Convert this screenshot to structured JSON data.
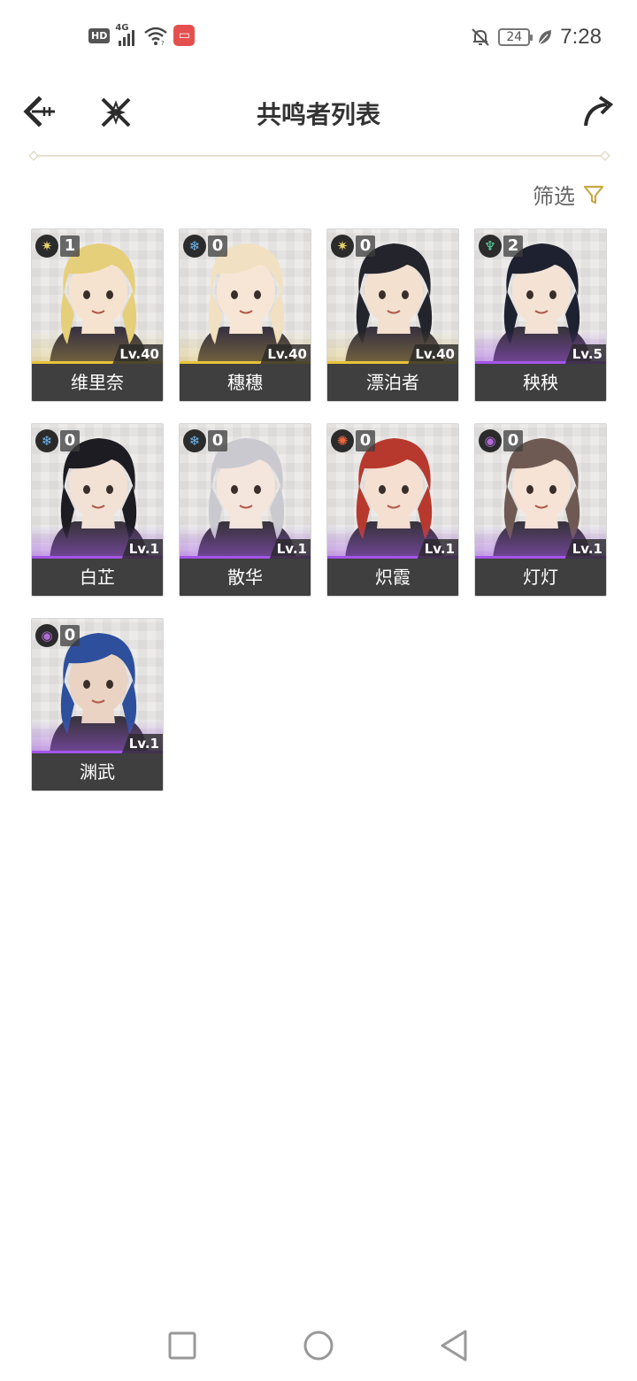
{
  "status_bar": {
    "hd_label": "HD",
    "network_label": "4G",
    "battery_level": "24",
    "time": "7:28"
  },
  "header": {
    "title": "共鸣者列表"
  },
  "filter": {
    "label": "筛选"
  },
  "colors": {
    "five_star": "#e8c23a",
    "four_star": "#a455e8",
    "card_name_bg": "#3f3f3f"
  },
  "characters": [
    {
      "name": "维里奈",
      "chain": "1",
      "level": "Lv.40",
      "element": "spectro-icon",
      "rarity": 5,
      "hair": "#e6cf7a",
      "skin": "#f6e3cf"
    },
    {
      "name": "穗穗",
      "chain": "0",
      "level": "Lv.40",
      "element": "glacio-icon",
      "rarity": 5,
      "hair": "#f1e1c2",
      "skin": "#f7e6d6"
    },
    {
      "name": "漂泊者",
      "chain": "0",
      "level": "Lv.40",
      "element": "spectro-icon",
      "rarity": 5,
      "hair": "#23242c",
      "skin": "#f3e0cf"
    },
    {
      "name": "秧秧",
      "chain": "2",
      "level": "Lv.5",
      "element": "aero-icon",
      "rarity": 4,
      "hair": "#1e2130",
      "skin": "#f4e3d5"
    },
    {
      "name": "白芷",
      "chain": "0",
      "level": "Lv.1",
      "element": "glacio-icon",
      "rarity": 4,
      "hair": "#1c1c22",
      "skin": "#f2e2d6"
    },
    {
      "name": "散华",
      "chain": "0",
      "level": "Lv.1",
      "element": "glacio-icon",
      "rarity": 4,
      "hair": "#c9c9cf",
      "skin": "#f4e6dc"
    },
    {
      "name": "炽霞",
      "chain": "0",
      "level": "Lv.1",
      "element": "fusion-icon",
      "rarity": 4,
      "hair": "#b7392d",
      "skin": "#f4dfd0"
    },
    {
      "name": "灯灯",
      "chain": "0",
      "level": "Lv.1",
      "element": "havoc-icon",
      "rarity": 4,
      "hair": "#6e5a52",
      "skin": "#f6e3d6"
    },
    {
      "name": "渊武",
      "chain": "0",
      "level": "Lv.1",
      "element": "havoc-icon",
      "rarity": 4,
      "hair": "#2e4f9c",
      "skin": "#ead3c2"
    }
  ]
}
